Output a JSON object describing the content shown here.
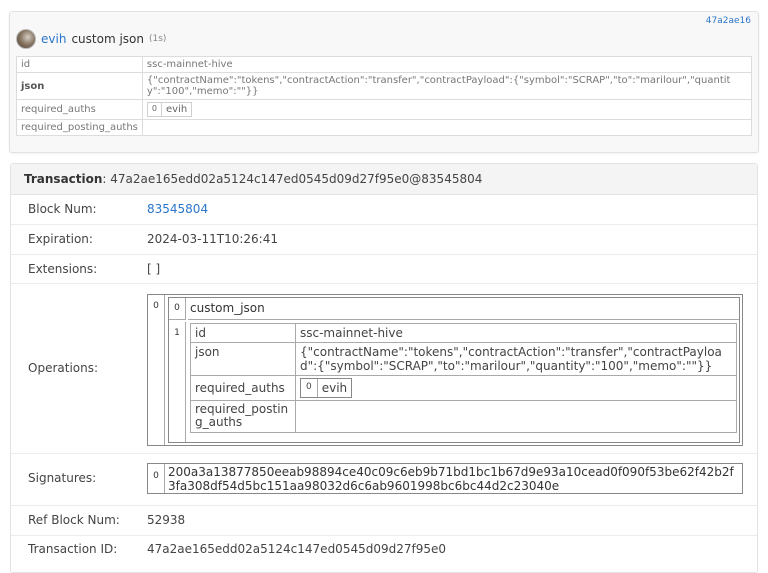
{
  "op": {
    "tx_hash_short": "47a2ae16",
    "user": "evih",
    "type": "custom json",
    "age": "(1s)",
    "rows": [
      {
        "key": "id",
        "value": "ssc-mainnet-hive"
      },
      {
        "key": "json",
        "value": "{\"contractName\":\"tokens\",\"contractAction\":\"transfer\",\"contractPayload\":{\"symbol\":\"SCRAP\",\"to\":\"marilour\",\"quantity\":\"100\",\"memo\":\"\"}}"
      },
      {
        "key": "required_auths",
        "index": "0",
        "value": "evih"
      },
      {
        "key": "required_posting_auths",
        "value": ""
      }
    ]
  },
  "tx": {
    "header_label": "Transaction",
    "header_value": ": 47a2ae165edd02a5124c147ed0545d09d27f95e0@83545804",
    "block_num_label": "Block Num:",
    "block_num": "83545804",
    "expiration_label": "Expiration:",
    "expiration": "2024-03-11T10:26:41",
    "extensions_label": "Extensions:",
    "extensions": "[ ]",
    "operations_label": "Operations:",
    "operations": {
      "outer_index": "0",
      "inner_index": "0",
      "op_name": "custom_json",
      "params_index": "1",
      "params": [
        {
          "key": "id",
          "value": "ssc-mainnet-hive"
        },
        {
          "key": "json",
          "value": "{\"contractName\":\"tokens\",\"contractAction\":\"transfer\",\"contractPayload\":{\"symbol\":\"SCRAP\",\"to\":\"marilour\",\"quantity\":\"100\",\"memo\":\"\"}}"
        },
        {
          "key": "required_auths",
          "index": "0",
          "value": "evih"
        },
        {
          "key": "required_posting_auths",
          "value": ""
        }
      ]
    },
    "signatures_label": "Signatures:",
    "signature_index": "0",
    "signature": "200a3a13877850eeab98894ce40c09c6eb9b71bd1bc1b67d9e93a10cead0f090f53be62f42b2f3fa308df54d5bc151aa98032d6c6ab9601998bc6bc44d2c23040e",
    "ref_block_label": "Ref Block Num:",
    "ref_block": "52938",
    "txid_label": "Transaction ID:",
    "txid": "47a2ae165edd02a5124c147ed0545d09d27f95e0"
  }
}
